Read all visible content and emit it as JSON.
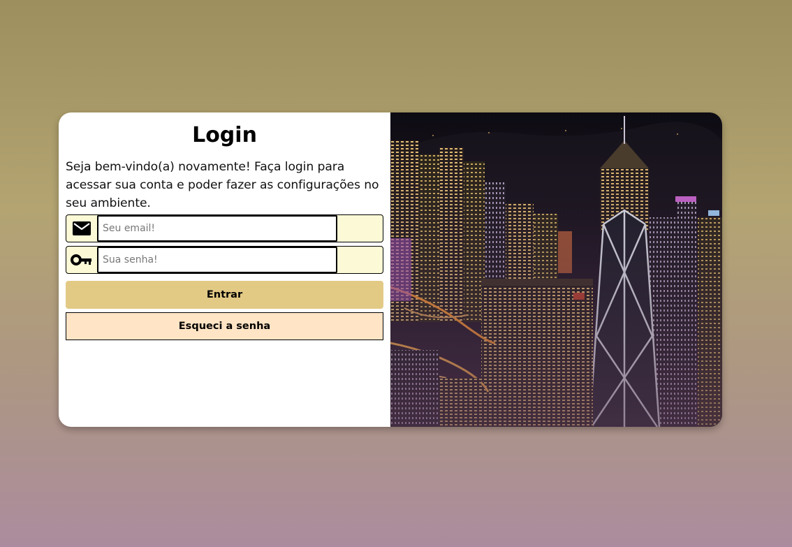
{
  "login": {
    "title": "Login",
    "intro": "Seja bem-vindo(a) novamente! Faça login para acessar sua conta e poder fazer as configurações no seu ambiente.",
    "email": {
      "placeholder": "Seu email!",
      "value": "",
      "icon": "mail-icon"
    },
    "password": {
      "placeholder": "Sua senha!",
      "value": "",
      "icon": "key-icon"
    },
    "submit_label": "Entrar",
    "forgot_label": "Esqueci a senha"
  },
  "colors": {
    "submit_bg": "#e2ca85",
    "forgot_bg": "#ffe4c5",
    "field_bg": "#fbf9d6"
  },
  "hero_image": {
    "subject": "night city skyline"
  }
}
